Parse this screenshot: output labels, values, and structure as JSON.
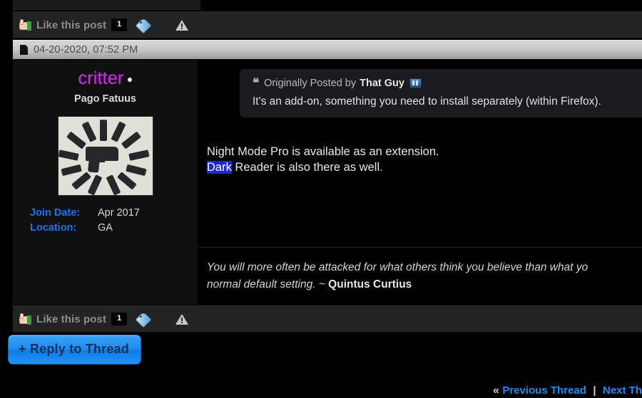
{
  "post": {
    "date": "04-20-2020, 07:52 PM",
    "author": {
      "username": "critter",
      "title": "Pago Fatuus",
      "join_date_label": "Join Date:",
      "join_date_value": "Apr 2017",
      "location_label": "Location:",
      "location_value": "GA"
    },
    "quote": {
      "intro": "Originally Posted by",
      "author": "That Guy",
      "text": "It's an add-on, something you need to install separately (within Firefox)."
    },
    "body_line_1": "Night Mode Pro is available as an extension.",
    "body_selected": "Dark",
    "body_line_2_rest": " Reader is also there as well.",
    "signature_line_1": "You will more often be attacked for what others think you believe than what yo",
    "signature_line_2_prefix": "normal default setting. ~ ",
    "signature_line_2_author": "Quintus Curtius"
  },
  "likebar": {
    "label": "Like this post",
    "count": "1"
  },
  "actions": {
    "reply_label": "+ Reply to Thread"
  },
  "bottom_nav": {
    "prev_chevron": "«",
    "prev_label": "Previous Thread",
    "separator": "|",
    "next_label": "Next Th"
  },
  "colors": {
    "username": "#c034d6",
    "meta_key": "#1a72e8",
    "link": "#1f8cf0",
    "selection": "#1a2ad0",
    "reply_button": "#1f8cf0"
  }
}
